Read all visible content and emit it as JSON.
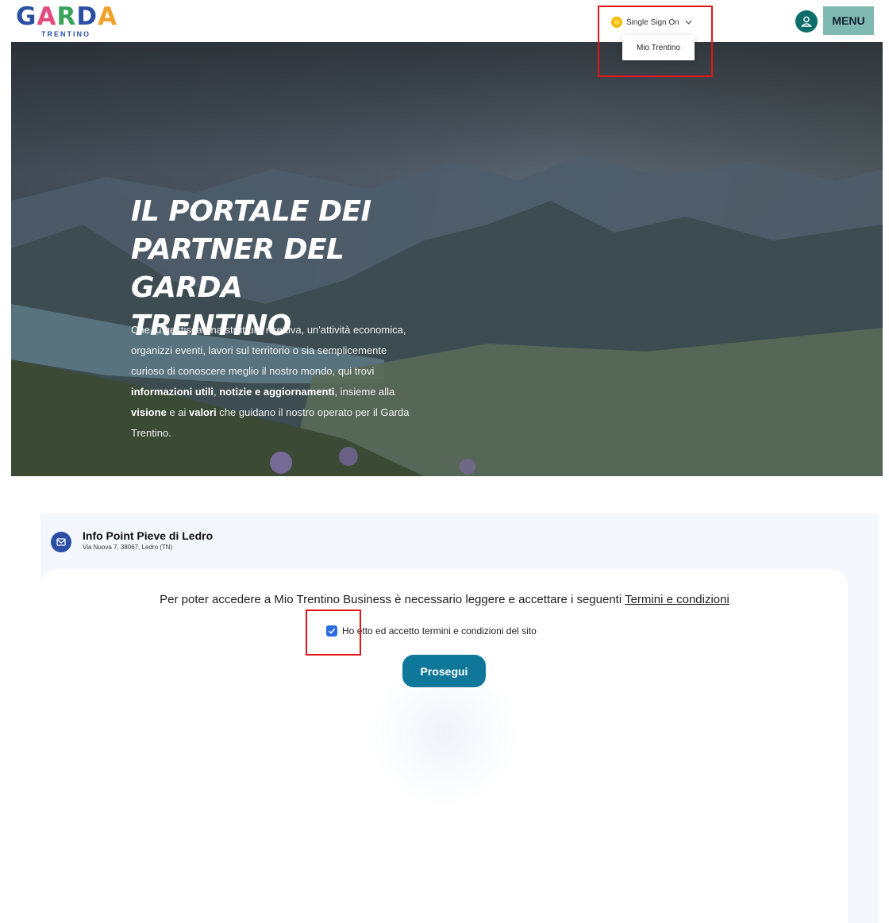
{
  "header": {
    "logo": {
      "word_letters": [
        "G",
        "A",
        "R",
        "D",
        "A"
      ],
      "subtitle": "TRENTINO"
    },
    "sso": {
      "label": "Single Sign On",
      "icon": "sso-icon",
      "chevron": "chevron-down-icon"
    },
    "sso_menu": {
      "items": [
        "Mio Trentino"
      ]
    },
    "user_icon": "user-icon",
    "menu_label": "MENU",
    "colors": {
      "teal": "#0c6e6a",
      "menu_bg": "#7fb9b2",
      "highlight": "#e01616"
    }
  },
  "hero": {
    "title_lines": [
      "IL PORTALE DEI",
      "PARTNER DEL GARDA",
      "TRENTINO"
    ],
    "text": {
      "p1": "Che tu gestisca una struttura ricettiva, un'attività economica, organizzi eventi, lavori sul territorio o sia semplicemente curioso di conoscere meglio il nostro mondo, qui trovi ",
      "b1": "informazioni utili",
      "p2": ", ",
      "b2": "notizie e aggiornamenti",
      "p3": ", insieme alla ",
      "b3": "visione",
      "p4": " e ai ",
      "b4": "valori",
      "p5": " che guidano il nostro operato per il Garda Trentino."
    }
  },
  "info_point": {
    "icon": "info-point-icon",
    "title": "Info Point Pieve di Ledro",
    "address": "Via Nuova 7, 38067, Ledro (TN)"
  },
  "terms": {
    "prefix": "Per poter accedere a Mio Trentino Business è necessario leggere e accettare i seguenti ",
    "link": "Termini e condizioni",
    "checkbox_label_start": "Ho",
    "checkbox_label_end": "etto ed accetto termini e condizioni del sito",
    "checked": true,
    "button": "Prosegui",
    "button_color": "#0f789a"
  }
}
